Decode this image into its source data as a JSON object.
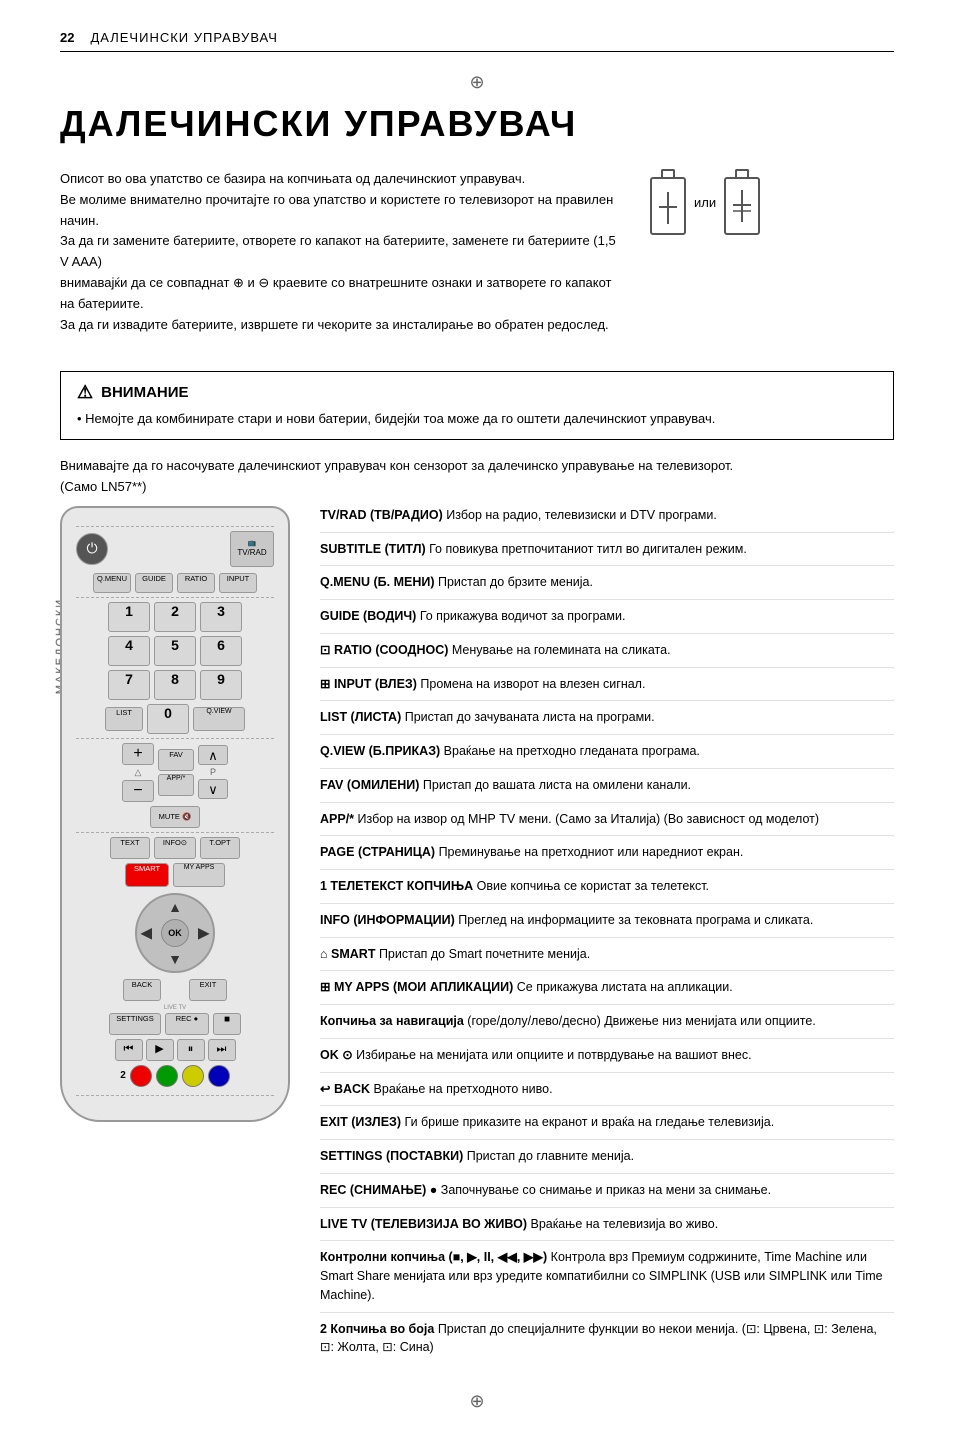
{
  "header": {
    "page_num": "22",
    "title": "ДАЛЕЧИНСКИ УПРАВУВАЧ"
  },
  "main_title": "ДАЛЕЧИНСКИ УПРАВУВАЧ",
  "intro": {
    "line1": "Описот во ова упатство се базира на копчињата од далечинскиот управувач.",
    "line2": "Ве молиме внимателно прочитајте го ова упатство и користете го телевизорот на правилен начин.",
    "line3": "За да ги замените батериите, отворете го капакот на батериите, заменете ги батериите (1,5 V AAA)",
    "line4": "внимавајќи да се совпаднат ⊕ и ⊖ краевите со внатрешните ознаки и затворете го капакот на батериите.",
    "line5": "За да ги извадите батериите, извршете ги чекорите за инсталирање во обратен редослед.",
    "battery_or": "или"
  },
  "warning": {
    "title": "ВНИМАНИЕ",
    "text": "Немојте да комбинирате стари и нови батерии, бидејќи тоа може да го оштети далечинскиот управувач."
  },
  "direction_note": "Внимавајте да го насочувате далечинскиот управувач кон сензорот за далечинско управување на телевизорот.",
  "model_note": "(Само LN57**)",
  "side_label": "МАКЕДОНСКИ",
  "remote": {
    "power_symbol": "⏻",
    "tv_rad_label": "TV/RAD",
    "ratio_label": "RATIO",
    "input_label": "INPUT",
    "qmenu_label": "Q.MENU",
    "guide_label": "GUIDE",
    "nums": [
      "1",
      "2",
      "3",
      "4",
      "5",
      "6",
      "7",
      "8",
      "9",
      "0"
    ],
    "list_label": "LIST",
    "qview_label": "Q.VIEW",
    "plus_label": "+",
    "minus_label": "−",
    "fav_label": "FAV",
    "app_label": "APP/*",
    "page_up": "∧",
    "page_dn": "∨",
    "mute_label": "MUTE 🔇",
    "text_label": "TEXT",
    "info_label": "INFO⊙",
    "topt_label": "T.OPT",
    "smart_label": "SMART",
    "myapps_label": "MY APPS",
    "ok_label": "OK",
    "back_label": "BACK",
    "exit_label": "EXIT",
    "livetv_label": "LIVE TV",
    "settings_label": "SETTINGS",
    "rec_label": "REC ●",
    "stop_label": "■",
    "transport_labels": [
      "⏮",
      "▶",
      "⏸",
      "⏭"
    ],
    "color_btns": [
      "red",
      "green",
      "yellow",
      "blue"
    ],
    "num_2_label": "2"
  },
  "descriptions": [
    {
      "id": "tv-rad",
      "bold": "TV/RAD (ТВ/РАДИО)",
      "text": " Избор на радио, телевизиски и DTV програми."
    },
    {
      "id": "subtitle",
      "bold": "SUBTITLE (ТИТЛ)",
      "text": " Го повикува претпочитаниот титл во дигитален режим."
    },
    {
      "id": "qmenu",
      "bold": "Q.MENU (Б. МЕНИ)",
      "text": " Пристап до брзите менија."
    },
    {
      "id": "guide",
      "bold": "GUIDE (ВОДИЧ)",
      "text": " Го прикажува водичот за програми."
    },
    {
      "id": "ratio",
      "bold": "⊡ RATIO (СООДНОС)",
      "text": " Менување на големината на сликата."
    },
    {
      "id": "input",
      "bold": "⊞ INPUT (ВЛЕЗ)",
      "text": " Промена на изворот на влезен сигнал."
    },
    {
      "id": "list",
      "bold": "LIST (ЛИСТА)",
      "text": " Пристап до зачуваната листа на програми."
    },
    {
      "id": "qview",
      "bold": "Q.VIEW (Б.ПРИКАЗ)",
      "text": " Враќање на претходно гледаната програма."
    },
    {
      "id": "fav",
      "bold": "FAV (ОМИЛЕНИ)",
      "text": " Пристап до вашата листа на омилени канали."
    },
    {
      "id": "app",
      "bold": "APP/*",
      "text": " Избор на извор од МНР TV мени. (Само за Италија) (Во зависност од моделот)"
    },
    {
      "id": "page",
      "bold": "PAGE (СТРАНИЦА)",
      "text": " Преминување на претходниот или наредниот екран."
    },
    {
      "id": "teletext",
      "bold": "1 ТЕЛЕТЕКСТ КОПЧИЊА",
      "text": " Овие копчиња се користат за телетекст."
    },
    {
      "id": "info",
      "bold": "INFO (ИНФОРМАЦИИ)",
      "text": " Преглед на информациите за тековната програма и сликата."
    },
    {
      "id": "smart",
      "bold": "⌂ SMART",
      "text": " Пристап до Smart почетните менија."
    },
    {
      "id": "myapps",
      "bold": "⊞ MY APPS (МОИ АПЛИКАЦИИ)",
      "text": " Се прикажува листата на апликации."
    },
    {
      "id": "nav",
      "bold": "Копчиња за навигација",
      "text": " (горе/долу/лево/десно) Движење низ менијата или опциите."
    },
    {
      "id": "ok",
      "bold": "OK ⊙",
      "text": " Избирање на менијата или опциите и потврдување на вашиот внес."
    },
    {
      "id": "back",
      "bold": "↩ BACK",
      "text": " Враќање на претходното ниво."
    },
    {
      "id": "exit",
      "bold": "EXIT (ИЗЛЕЗ)",
      "text": "  Ги брише приказите на екранот и враќа на гледање телевизија."
    },
    {
      "id": "settings",
      "bold": "SETTINGS (ПОСТАВКИ)",
      "text": " Пристап до главните менија."
    },
    {
      "id": "rec",
      "bold": "REC (СНИМАЊЕ) ●",
      "text": " Започнување со снимање и приказ на мени за снимање."
    },
    {
      "id": "livetv",
      "bold": "LIVE TV (ТЕЛЕВИЗИЈА ВО ЖИВО)",
      "text": " Враќање на телевизија во живо."
    },
    {
      "id": "controls",
      "bold": "Контролни копчиња (■, ▶, II, ◀◀, ▶▶)",
      "text": " Контрола врз Премиум содржините, Time Machine или Smart Share менијата или врз уредите компатибилни со SIMPLINK (USB или SIMPLINK или Time Machine)."
    },
    {
      "id": "colorbtns",
      "bold": "2 Копчиња во боја",
      "text": " Пристап до специјалните функции во некои менија. (⊡: Црвена, ⊡: Зелена, ⊡: Жолта, ⊡: Сина)"
    }
  ]
}
